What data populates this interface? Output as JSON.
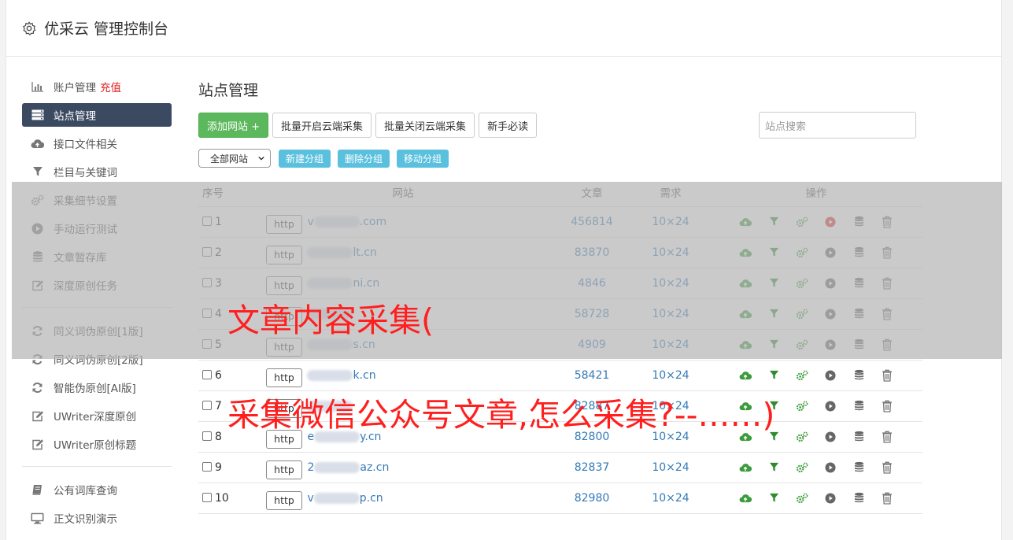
{
  "app": {
    "title": "优采云 管理控制台"
  },
  "sidebar": {
    "items": [
      {
        "label": "账户管理",
        "extra": "充值",
        "icon": "bar-chart-icon"
      },
      {
        "label": "站点管理",
        "icon": "server-icon",
        "active": true
      },
      {
        "label": "接口文件相关",
        "icon": "cloud-upload-icon"
      },
      {
        "label": "栏目与关键词",
        "icon": "filter-icon"
      },
      {
        "label": "采集细节设置",
        "icon": "cogs-icon"
      },
      {
        "label": "手动运行测试",
        "icon": "play-circle-icon"
      },
      {
        "label": "文章暂存库",
        "icon": "database-icon"
      },
      {
        "label": "深度原创任务",
        "icon": "edit-icon"
      }
    ],
    "items2": [
      {
        "label": "同义词伪原创[1版]",
        "icon": "refresh-icon"
      },
      {
        "label": "同义词伪原创[2版]",
        "icon": "refresh-icon"
      },
      {
        "label": "智能伪原创[AI版]",
        "icon": "refresh-icon"
      },
      {
        "label": "UWriter深度原创",
        "icon": "edit-icon"
      },
      {
        "label": "UWriter原创标题",
        "icon": "edit-icon"
      }
    ],
    "items3": [
      {
        "label": "公有词库查询",
        "icon": "book-icon"
      },
      {
        "label": "正文识别演示",
        "icon": "monitor-icon"
      }
    ]
  },
  "main": {
    "title": "站点管理",
    "add_button": "添加网站 +",
    "batch_open": "批量开启云端采集",
    "batch_close": "批量关闭云端采集",
    "guide": "新手必读",
    "search_placeholder": "站点搜索",
    "group_select": "全部网站",
    "new_group": "新建分组",
    "delete_group": "删除分组",
    "move_group": "移动分组"
  },
  "table": {
    "headers": [
      "序号",
      "网站",
      "文章",
      "需求",
      "操作"
    ],
    "rows": [
      {
        "no": "1",
        "scheme": "http",
        "pre": "v",
        "domain": ".com",
        "articles": "456814",
        "demand": "10×24",
        "running": true
      },
      {
        "no": "2",
        "scheme": "http",
        "pre": "",
        "domain": "lt.cn",
        "articles": "83870",
        "demand": "10×24"
      },
      {
        "no": "3",
        "scheme": "http",
        "pre": "",
        "domain": "ni.cn",
        "articles": "4846",
        "demand": "10×24"
      },
      {
        "no": "4",
        "scheme": "http",
        "pre": "",
        "domain": "",
        "articles": "58728",
        "demand": "10×24"
      },
      {
        "no": "5",
        "scheme": "http",
        "pre": "",
        "domain": "s.cn",
        "articles": "4909",
        "demand": "10×24"
      },
      {
        "no": "6",
        "scheme": "http",
        "pre": "",
        "domain": "k.cn",
        "articles": "58421",
        "demand": "10×24"
      },
      {
        "no": "7",
        "scheme": "http",
        "pre": "",
        "domain": "",
        "articles": "82887",
        "demand": "10×24"
      },
      {
        "no": "8",
        "scheme": "http",
        "pre": "e",
        "domain": "y.cn",
        "articles": "82800",
        "demand": "10×24"
      },
      {
        "no": "9",
        "scheme": "http",
        "pre": "2",
        "domain": "az.cn",
        "articles": "82837",
        "demand": "10×24"
      },
      {
        "no": "10",
        "scheme": "http",
        "pre": "v",
        "domain": "p.cn",
        "articles": "82980",
        "demand": "10×24"
      }
    ]
  },
  "overlay": {
    "line1": "文章内容采集(",
    "line2": "采集微信公众号文章,怎么采集?--……)"
  },
  "colors": {
    "accent": "#3b4a61",
    "green": "#5cb85c",
    "info": "#5bc0de",
    "link": "#337ab7",
    "overlay_text": "#ff1f1f"
  }
}
